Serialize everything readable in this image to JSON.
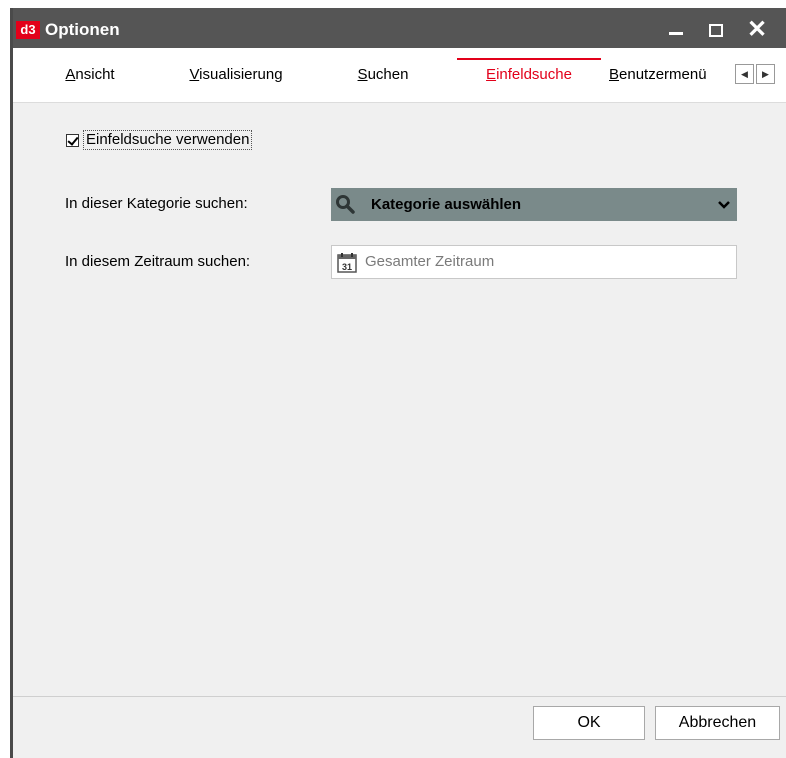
{
  "window": {
    "title": "Optionen",
    "logo_text": "d3",
    "logo_color": "#e2001a",
    "titlebar_color": "#555555"
  },
  "tabs": [
    {
      "label": "Ansicht",
      "mnemonic": "A",
      "rest": "nsicht"
    },
    {
      "label": "Visualisierung",
      "mnemonic": "V",
      "rest": "isualisierung"
    },
    {
      "label": "Suchen",
      "mnemonic": "S",
      "rest": "uchen"
    },
    {
      "label": "Einfeldsuche",
      "mnemonic": "E",
      "rest": "infeldsuche",
      "active": true
    },
    {
      "label": "Benutzermenü",
      "mnemonic": "B",
      "rest": "enutzermenü"
    }
  ],
  "settings": {
    "use_checkbox": {
      "label": "Einfeldsuche verwenden",
      "checked": true
    },
    "category_label": "In dieser Kategorie suchen:",
    "category_value": "Kategorie auswählen",
    "timerange_label": "In diesem Zeitraum suchen:",
    "timerange_value": "Gesamter Zeitraum",
    "calendar_day": "31"
  },
  "buttons": {
    "ok": "OK",
    "cancel": "Abbrechen"
  },
  "icons": {
    "search": "search-icon",
    "chevron": "chevron-down-icon",
    "calendar": "calendar-icon",
    "minimize": "minimize-icon",
    "maximize": "maximize-icon",
    "close": "close-icon"
  }
}
